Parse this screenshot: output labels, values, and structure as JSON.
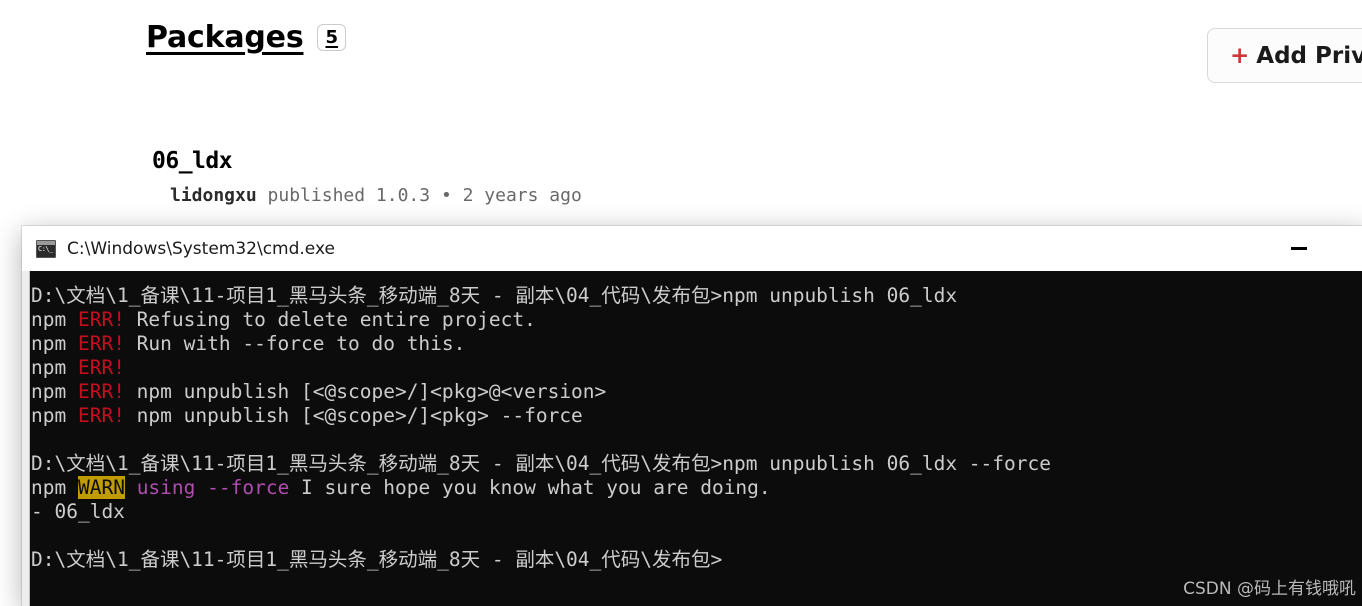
{
  "npm_page": {
    "header": {
      "title": "Packages",
      "count_badge": "5",
      "add_button_label": "+ Add Private",
      "add_button_plus": "+",
      "add_button_text": " Add Private"
    },
    "packages": [
      {
        "name": "06_ldx",
        "author": "lidongxu",
        "published_word": "published",
        "version": "1.0.3",
        "separator": "•",
        "age": "2 years ago",
        "meta_line": "published 1.0.3 • 2 years ago"
      }
    ]
  },
  "cmd_window": {
    "title": "C:\\Windows\\System32\\cmd.exe",
    "icon": "cmd-icon",
    "minimize_label": "—",
    "prompt_path": "D:\\文档\\1_备课\\11-项目1_黑马头条_移动端_8天 - 副本\\04_代码\\发布包>",
    "lines": [
      {
        "segments": [
          {
            "text": "D:\\文档\\1_备课\\11-项目1_黑马头条_移动端_8天 - 副本\\04_代码\\发布包>npm unpublish 06_ldx",
            "style": "default"
          }
        ]
      },
      {
        "segments": [
          {
            "text": "npm ",
            "style": "default"
          },
          {
            "text": "ERR!",
            "style": "err"
          },
          {
            "text": " Refusing to delete entire project.",
            "style": "default"
          }
        ]
      },
      {
        "segments": [
          {
            "text": "npm ",
            "style": "default"
          },
          {
            "text": "ERR!",
            "style": "err"
          },
          {
            "text": " Run with --force to do this.",
            "style": "default"
          }
        ]
      },
      {
        "segments": [
          {
            "text": "npm ",
            "style": "default"
          },
          {
            "text": "ERR!",
            "style": "err"
          }
        ]
      },
      {
        "segments": [
          {
            "text": "npm ",
            "style": "default"
          },
          {
            "text": "ERR!",
            "style": "err"
          },
          {
            "text": " npm unpublish [<@scope>/]<pkg>@<version>",
            "style": "default"
          }
        ]
      },
      {
        "segments": [
          {
            "text": "npm ",
            "style": "default"
          },
          {
            "text": "ERR!",
            "style": "err"
          },
          {
            "text": " npm unpublish [<@scope>/]<pkg> --force",
            "style": "default"
          }
        ]
      },
      {
        "segments": []
      },
      {
        "segments": [
          {
            "text": "D:\\文档\\1_备课\\11-项目1_黑马头条_移动端_8天 - 副本\\04_代码\\发布包>npm unpublish 06_ldx --force",
            "style": "default"
          }
        ]
      },
      {
        "segments": [
          {
            "text": "npm ",
            "style": "default"
          },
          {
            "text": "WARN",
            "style": "warn"
          },
          {
            "text": " ",
            "style": "default"
          },
          {
            "text": "using --force",
            "style": "magenta"
          },
          {
            "text": " I sure hope you know what you are doing.",
            "style": "default"
          }
        ]
      },
      {
        "segments": [
          {
            "text": "- 06_ldx",
            "style": "default"
          }
        ]
      },
      {
        "segments": []
      },
      {
        "segments": [
          {
            "text": "D:\\文档\\1_备课\\11-项目1_黑马头条_移动端_8天 - 副本\\04_代码\\发布包>",
            "style": "default"
          }
        ]
      }
    ]
  },
  "watermark": {
    "text": "CSDN @码上有钱哦吼"
  },
  "colors": {
    "terminal_background": "#0c0c0c",
    "terminal_foreground": "#cccccc",
    "error_red": "#c50f1f",
    "warn_background": "#c19c00",
    "magenta": "#b14cb1",
    "npm_red": "#cb3837"
  }
}
